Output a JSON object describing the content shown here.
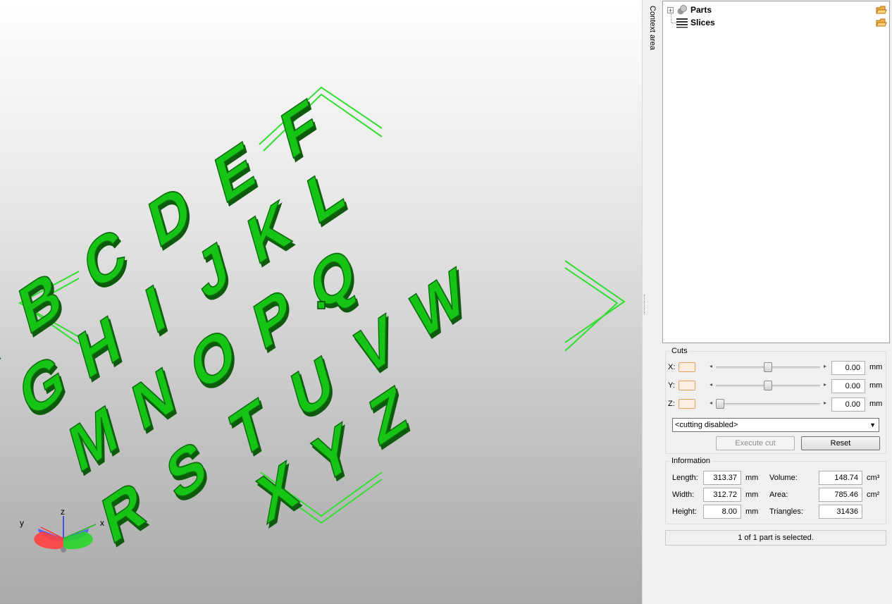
{
  "viewport": {
    "model_color": "#19c419",
    "bbox_color": "#33dd33",
    "letter_rows": [
      "ABCDEF",
      "GHIJKL",
      "MNOPQ",
      "RSTUVW",
      "XYZ"
    ],
    "axis_labels": {
      "x": "x",
      "y": "y",
      "z": "z"
    }
  },
  "context_tab": {
    "label": "Context area"
  },
  "tree": {
    "items": [
      {
        "label": "Parts",
        "icon": "parts-icon",
        "expander": "+",
        "action_icon": "open-folder-icon"
      },
      {
        "label": "Slices",
        "icon": "slices-icon",
        "action_icon": "open-folder-icon"
      }
    ]
  },
  "cuts": {
    "title": "Cuts",
    "axes": [
      {
        "label": "X:",
        "value": "0.00",
        "unit": "mm",
        "position": 0.5
      },
      {
        "label": "Y:",
        "value": "0.00",
        "unit": "mm",
        "position": 0.5
      },
      {
        "label": "Z:",
        "value": "0.00",
        "unit": "mm",
        "position": 0.0
      }
    ],
    "mode": "<cutting disabled>",
    "execute_label": "Execute cut",
    "reset_label": "Reset"
  },
  "information": {
    "title": "Information",
    "length_label": "Length:",
    "length_value": "313.37",
    "length_unit": "mm",
    "width_label": "Width:",
    "width_value": "312.72",
    "width_unit": "mm",
    "height_label": "Height:",
    "height_value": "8.00",
    "height_unit": "mm",
    "volume_label": "Volume:",
    "volume_value": "148.74",
    "volume_unit": "cm³",
    "area_label": "Area:",
    "area_value": "785.46",
    "area_unit": "cm²",
    "triangles_label": "Triangles:",
    "triangles_value": "31436"
  },
  "status": {
    "text": "1 of 1 part is selected."
  }
}
